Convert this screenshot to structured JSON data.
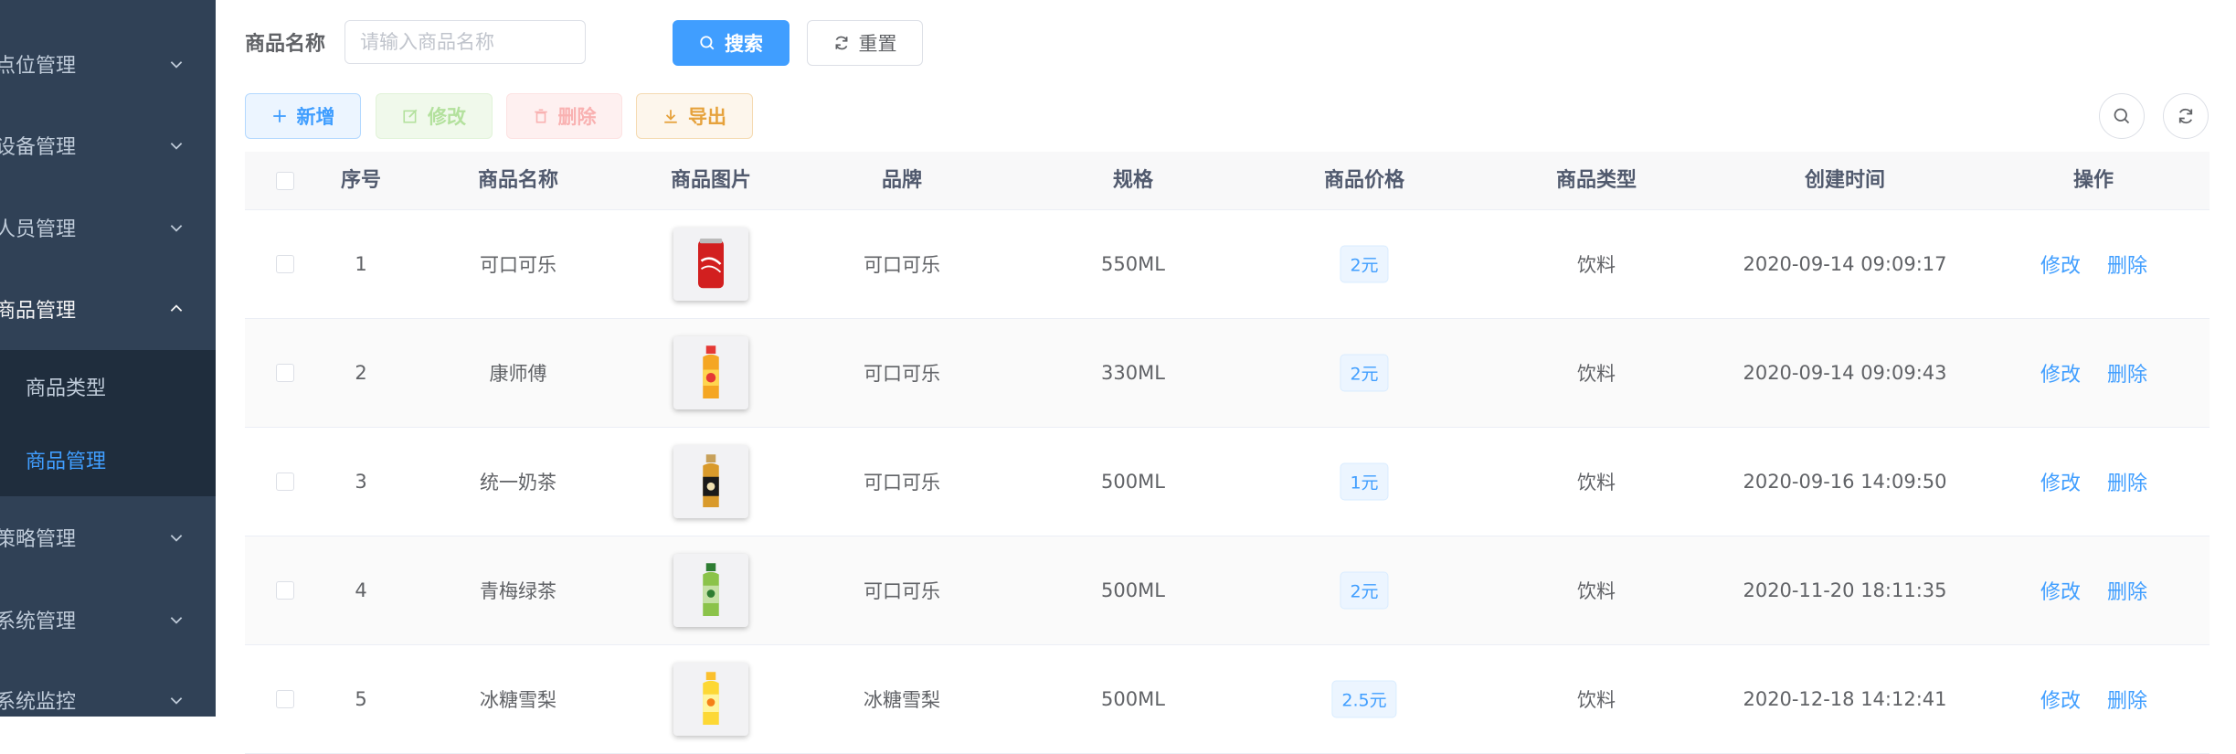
{
  "sidebar": {
    "menus": [
      {
        "label": "点位管理"
      },
      {
        "label": "设备管理"
      },
      {
        "label": "人员管理"
      },
      {
        "label": "商品管理"
      },
      {
        "label": "策略管理"
      },
      {
        "label": "系统管理"
      },
      {
        "label": "系统监控"
      }
    ],
    "submenu": [
      {
        "label": "商品类型"
      },
      {
        "label": "商品管理"
      }
    ],
    "active_submenu": "商品管理"
  },
  "search": {
    "label": "商品名称",
    "placeholder": "请输入商品名称",
    "value": "",
    "search_label": "搜索",
    "reset_label": "重置"
  },
  "toolbar": {
    "add_label": "新增",
    "edit_label": "修改",
    "delete_label": "删除",
    "export_label": "导出"
  },
  "table": {
    "headers": {
      "index": "序号",
      "name": "商品名称",
      "image": "商品图片",
      "brand": "品牌",
      "spec": "规格",
      "price": "商品价格",
      "type": "商品类型",
      "created": "创建时间",
      "actions": "操作"
    },
    "rows": [
      {
        "index": "1",
        "name": "可口可乐",
        "image_icon": "cola-can-icon",
        "brand": "可口可乐",
        "spec": "550ML",
        "price": "2元",
        "type": "饮料",
        "created": "2020-09-14 09:09:17",
        "edit": "修改",
        "delete": "删除"
      },
      {
        "index": "2",
        "name": "康师傅",
        "image_icon": "orange-drink-bottle-icon",
        "brand": "可口可乐",
        "spec": "330ML",
        "price": "2元",
        "type": "饮料",
        "created": "2020-09-14 09:09:43",
        "edit": "修改",
        "delete": "删除"
      },
      {
        "index": "3",
        "name": "统一奶茶",
        "image_icon": "milk-tea-bottle-icon",
        "brand": "可口可乐",
        "spec": "500ML",
        "price": "1元",
        "type": "饮料",
        "created": "2020-09-16 14:09:50",
        "edit": "修改",
        "delete": "删除"
      },
      {
        "index": "4",
        "name": "青梅绿茶",
        "image_icon": "green-tea-bottle-icon",
        "brand": "可口可乐",
        "spec": "500ML",
        "price": "2元",
        "type": "饮料",
        "created": "2020-11-20 18:11:35",
        "edit": "修改",
        "delete": "删除"
      },
      {
        "index": "5",
        "name": "冰糖雪梨",
        "image_icon": "pear-drink-bottle-icon",
        "brand": "冰糖雪梨",
        "spec": "500ML",
        "price": "2.5元",
        "type": "饮料",
        "created": "2020-12-18 14:12:41",
        "edit": "修改",
        "delete": "删除"
      }
    ]
  },
  "colors": {
    "sidebar_bg": "#304156",
    "submenu_bg": "#1f2d3d",
    "primary": "#409eff",
    "success_light": "#b3e19d",
    "danger_light": "#f9b1b1",
    "warning": "#e6a23c"
  }
}
